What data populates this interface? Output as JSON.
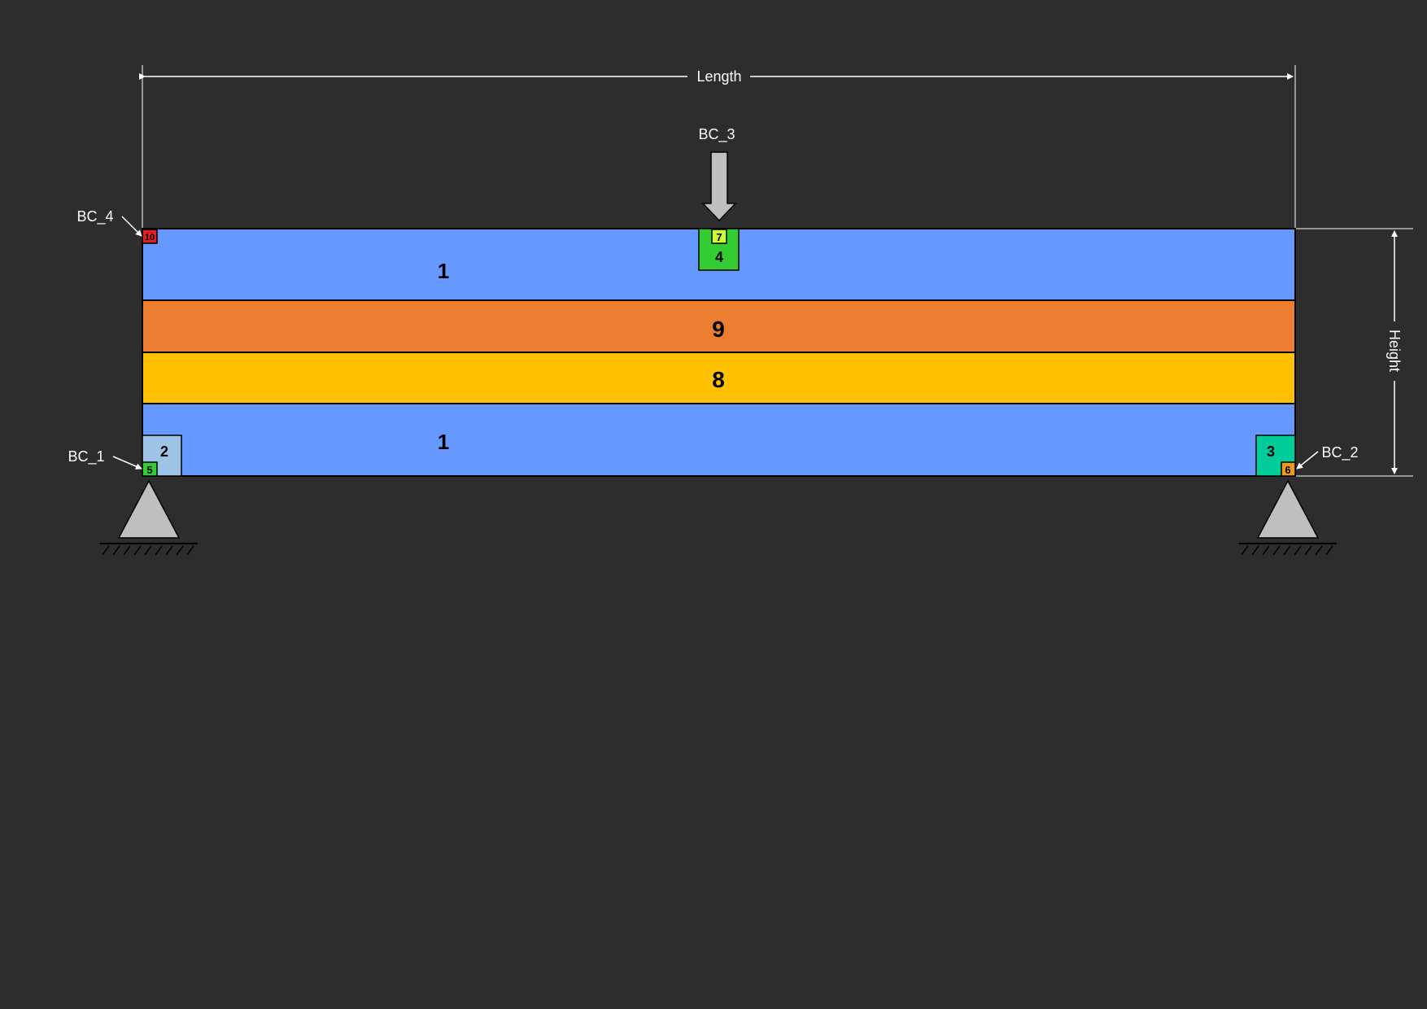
{
  "dimensions": {
    "length_label": "Length",
    "height_label": "Height"
  },
  "boundary_conditions": {
    "bc1": "BC_1",
    "bc2": "BC_2",
    "bc3": "BC_3",
    "bc4": "BC_4"
  },
  "layers": [
    {
      "id": "1",
      "color": "#6699ff"
    },
    {
      "id": "9",
      "color": "#ed7d31"
    },
    {
      "id": "8",
      "color": "#ffc000"
    },
    {
      "id": "1",
      "color": "#6699ff"
    }
  ],
  "regions": {
    "r2": {
      "label": "2",
      "color": "#9dc3e6"
    },
    "r3": {
      "label": "3",
      "color": "#00cc99"
    },
    "r4": {
      "label": "4",
      "color": "#33cc33"
    },
    "r5": {
      "label": "5",
      "color": "#33cc33"
    },
    "r6": {
      "label": "6",
      "color": "#ed9a1f"
    },
    "r7": {
      "label": "7",
      "color": "#ccff33"
    },
    "r10": {
      "label": "10",
      "color": "#e02020"
    }
  },
  "colors": {
    "background": "#2d2d2d",
    "support": "#bfbfbf",
    "arrow": "#bfbfbf",
    "dimension_line": "#ffffff"
  }
}
